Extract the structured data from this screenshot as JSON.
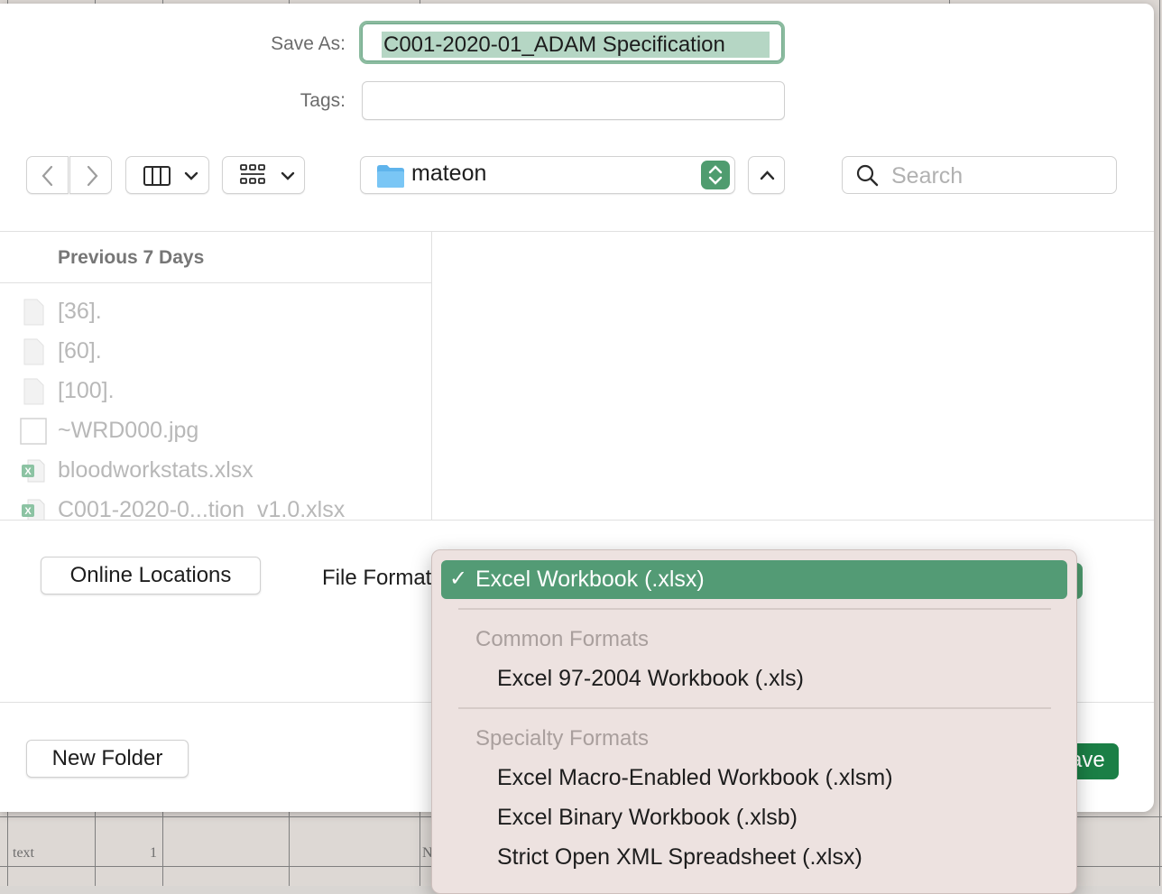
{
  "background_sheet": {
    "cells": [
      "text",
      "1",
      "N"
    ]
  },
  "dialog": {
    "save_as_label": "Save As:",
    "save_as_value": "C001-2020-01_ADAM Specification",
    "tags_label": "Tags:",
    "location": "mateon",
    "search_placeholder": "Search",
    "sidebar_section": "Previous 7 Days",
    "files": [
      {
        "name": "[36].",
        "icon": "document-icon"
      },
      {
        "name": "[60].",
        "icon": "document-icon"
      },
      {
        "name": "[100].",
        "icon": "document-icon"
      },
      {
        "name": "~WRD000.jpg",
        "icon": "image-icon"
      },
      {
        "name": "bloodworkstats.xlsx",
        "icon": "excel-icon"
      },
      {
        "name": "C001-2020-0...tion_v1.0.xlsx",
        "icon": "excel-icon"
      }
    ],
    "online_locations": "Online Locations",
    "file_format_label": "File Format:",
    "new_folder": "New Folder",
    "save_button": "Save"
  },
  "format_menu": {
    "selected_check": "✓",
    "selected": "Excel Workbook (.xlsx)",
    "common_header": "Common Formats",
    "common_items": [
      "Excel 97-2004 Workbook (.xls)"
    ],
    "specialty_header": "Specialty Formats",
    "specialty_items": [
      "Excel Macro-Enabled Workbook (.xlsm)",
      "Excel Binary Workbook (.xlsb)",
      "Strict Open XML Spreadsheet (.xlsx)"
    ]
  },
  "colors": {
    "accent": "#539b75",
    "save_button": "#1b7f46",
    "selection": "#b5d6c4"
  }
}
